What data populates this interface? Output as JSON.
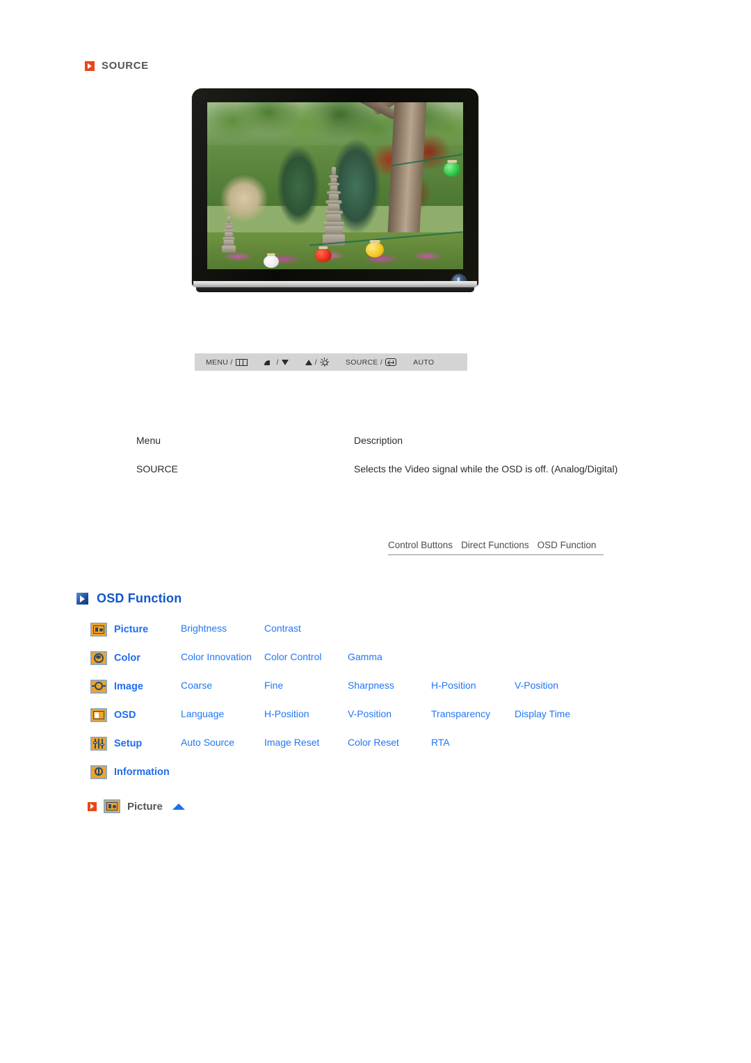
{
  "header": {
    "icon": "play-square-orange-icon",
    "title": "SOURCE"
  },
  "monitor": {
    "alt": "LCD monitor displaying a garden scene with stone pagodas, trees and paper lanterns",
    "power_button": "power-button"
  },
  "control_bar": {
    "items": [
      {
        "label": "MENU /",
        "icon": "menu-panel-icon"
      },
      {
        "icon_left": "contrast-icon",
        "sep": "/",
        "icon_right": "triangle-down-icon"
      },
      {
        "icon_left": "triangle-up-icon",
        "sep": "/",
        "icon_right": "brightness-sun-icon"
      },
      {
        "label": "SOURCE /",
        "icon": "enter-key-icon"
      },
      {
        "label": "AUTO"
      }
    ],
    "menu_label": "MENU /",
    "source_label": "SOURCE /",
    "auto_label": "AUTO",
    "separator": "/"
  },
  "description_table": {
    "headers": {
      "menu": "Menu",
      "description": "Description"
    },
    "rows": [
      {
        "menu": "SOURCE",
        "description": "Selects the Video signal while the OSD is off. (Analog/Digital)"
      }
    ]
  },
  "tabs": [
    {
      "label": "Control Buttons"
    },
    {
      "label": "Direct Functions"
    },
    {
      "label": "OSD Function"
    }
  ],
  "osd_function": {
    "icon": "play-square-blue-icon",
    "title": "OSD Function",
    "rows": [
      {
        "icon": "picture-menu-icon",
        "category": "Picture",
        "items": [
          "Brightness",
          "Contrast",
          "",
          "",
          ""
        ]
      },
      {
        "icon": "color-menu-icon",
        "category": "Color",
        "items": [
          "Color Innovation",
          "Color Control",
          "Gamma",
          "",
          ""
        ]
      },
      {
        "icon": "image-menu-icon",
        "category": "Image",
        "items": [
          "Coarse",
          "Fine",
          "Sharpness",
          "H-Position",
          "V-Position"
        ]
      },
      {
        "icon": "osd-menu-icon",
        "category": "OSD",
        "items": [
          "Language",
          "H-Position",
          "V-Position",
          "Transparency",
          "Display Time"
        ]
      },
      {
        "icon": "setup-menu-icon",
        "category": "Setup",
        "items": [
          "Auto Source",
          "Image Reset",
          "Color Reset",
          "RTA",
          ""
        ]
      },
      {
        "icon": "information-menu-icon",
        "category": "Information",
        "items": [
          "",
          "",
          "",
          "",
          ""
        ]
      }
    ]
  },
  "picture_section": {
    "play_icon": "play-square-orange-icon",
    "menu_icon": "picture-menu-icon",
    "title": "Picture",
    "back_to_top_icon": "triangle-up-blue-icon"
  },
  "colors": {
    "orange_accent": "#e8471b",
    "blue_link": "#2176f7",
    "blue_heading": "#1155cc",
    "icon_orange": "#f0a32a",
    "icon_border": "#93a8b8",
    "control_bar_bg": "#d4d4d4",
    "body_text": "#2b2b2b"
  }
}
